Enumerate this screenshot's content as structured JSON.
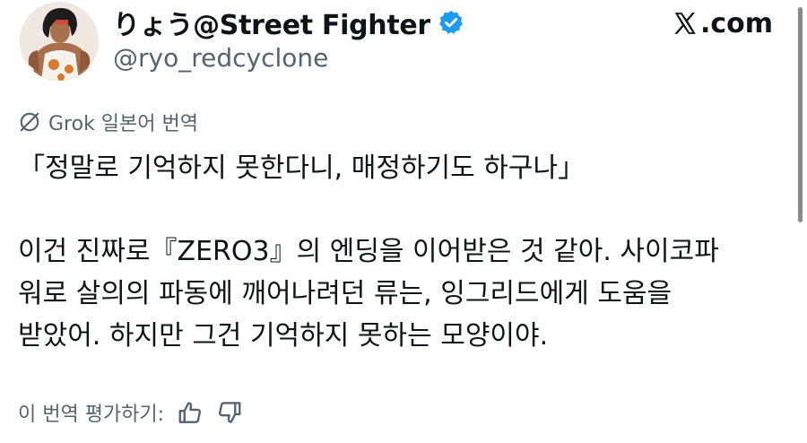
{
  "profile": {
    "display_name": "りょう@Street Fighter",
    "handle": "@ryo_redcyclone",
    "verified_icon": "verified-badge-icon",
    "avatar": "avatar-image"
  },
  "site": {
    "brand_suffix": ".com",
    "logo_icon": "x-logo-icon"
  },
  "translation": {
    "label": "Grok 일본어 번역",
    "icon": "grok-icon"
  },
  "tweet": {
    "lines": [
      "「정말로 기억하지 못한다니, 매정하기도 하구나」",
      "",
      "이건 진짜로『ZERO3』의 엔딩을 이어받은 것 같아. 사이코파",
      "워로 살의의 파동에 깨어나려던 류는, 잉그리드에게 도움을",
      "받았어. 하지만 그건 기억하지 못하는 모양이야."
    ]
  },
  "rating": {
    "label": "이 번역 평가하기:",
    "like_icon": "thumbs-up-icon",
    "dislike_icon": "thumbs-down-icon"
  },
  "colors": {
    "text": "#0f1419",
    "muted": "#536471",
    "verified": "#1d9bf0"
  }
}
